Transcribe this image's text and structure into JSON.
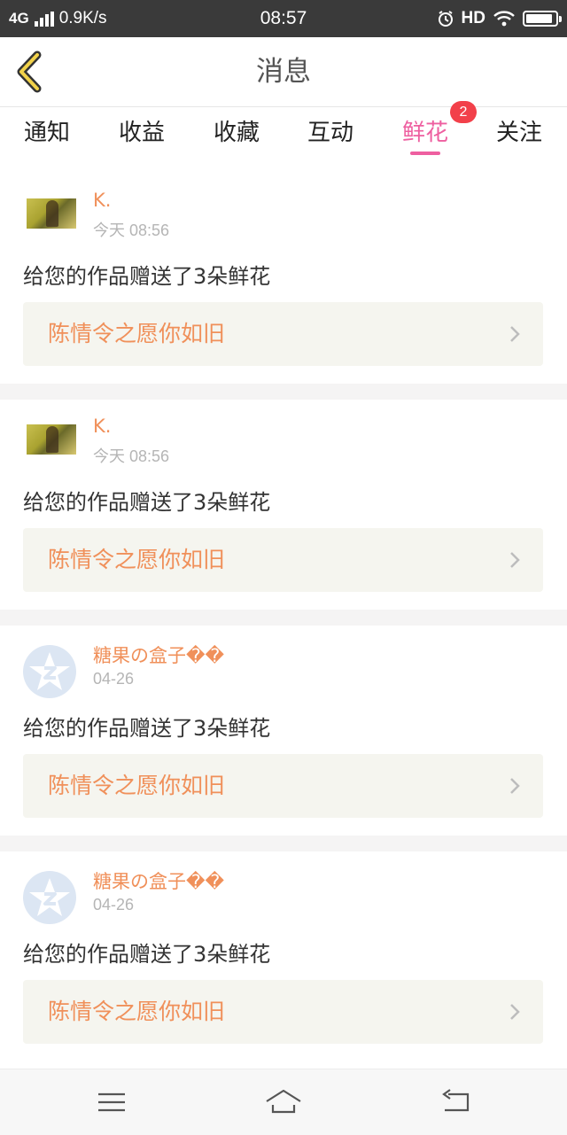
{
  "status_bar": {
    "network": "4G",
    "speed": "0.9K/s",
    "time": "08:57",
    "hd": "HD",
    "battery_level": 0.9
  },
  "header": {
    "title": "消息"
  },
  "tabs": [
    {
      "label": "通知"
    },
    {
      "label": "收益"
    },
    {
      "label": "收藏"
    },
    {
      "label": "互动"
    },
    {
      "label": "鲜花",
      "badge": "2",
      "active": true
    },
    {
      "label": "关注"
    }
  ],
  "feed": {
    "items": [
      {
        "user": "K.",
        "time": "今天 08:56",
        "message": "给您的作品赠送了3朵鲜花",
        "work_title": "陈情令之愿你如旧",
        "avatar": "photo"
      },
      {
        "user": "K.",
        "time": "今天 08:56",
        "message": "给您的作品赠送了3朵鲜花",
        "work_title": "陈情令之愿你如旧",
        "avatar": "photo"
      },
      {
        "user": "糖果の盒子��",
        "time": "04-26",
        "message": "给您的作品赠送了3朵鲜花",
        "work_title": "陈情令之愿你如旧",
        "avatar": "qq-icon"
      },
      {
        "user": "糖果の盒子��",
        "time": "04-26",
        "message": "给您的作品赠送了3朵鲜花",
        "work_title": "陈情令之愿你如旧",
        "avatar": "qq-icon"
      }
    ]
  },
  "colors": {
    "accent": "#ee5fa0",
    "username": "#f0905a",
    "badge": "#f2404a",
    "status_bar": "#3a3a3a"
  },
  "icons": {
    "back": "back-arrow-icon",
    "chevron": "chevron-right-icon",
    "nav": [
      "menu-icon",
      "home-icon",
      "return-icon"
    ]
  }
}
